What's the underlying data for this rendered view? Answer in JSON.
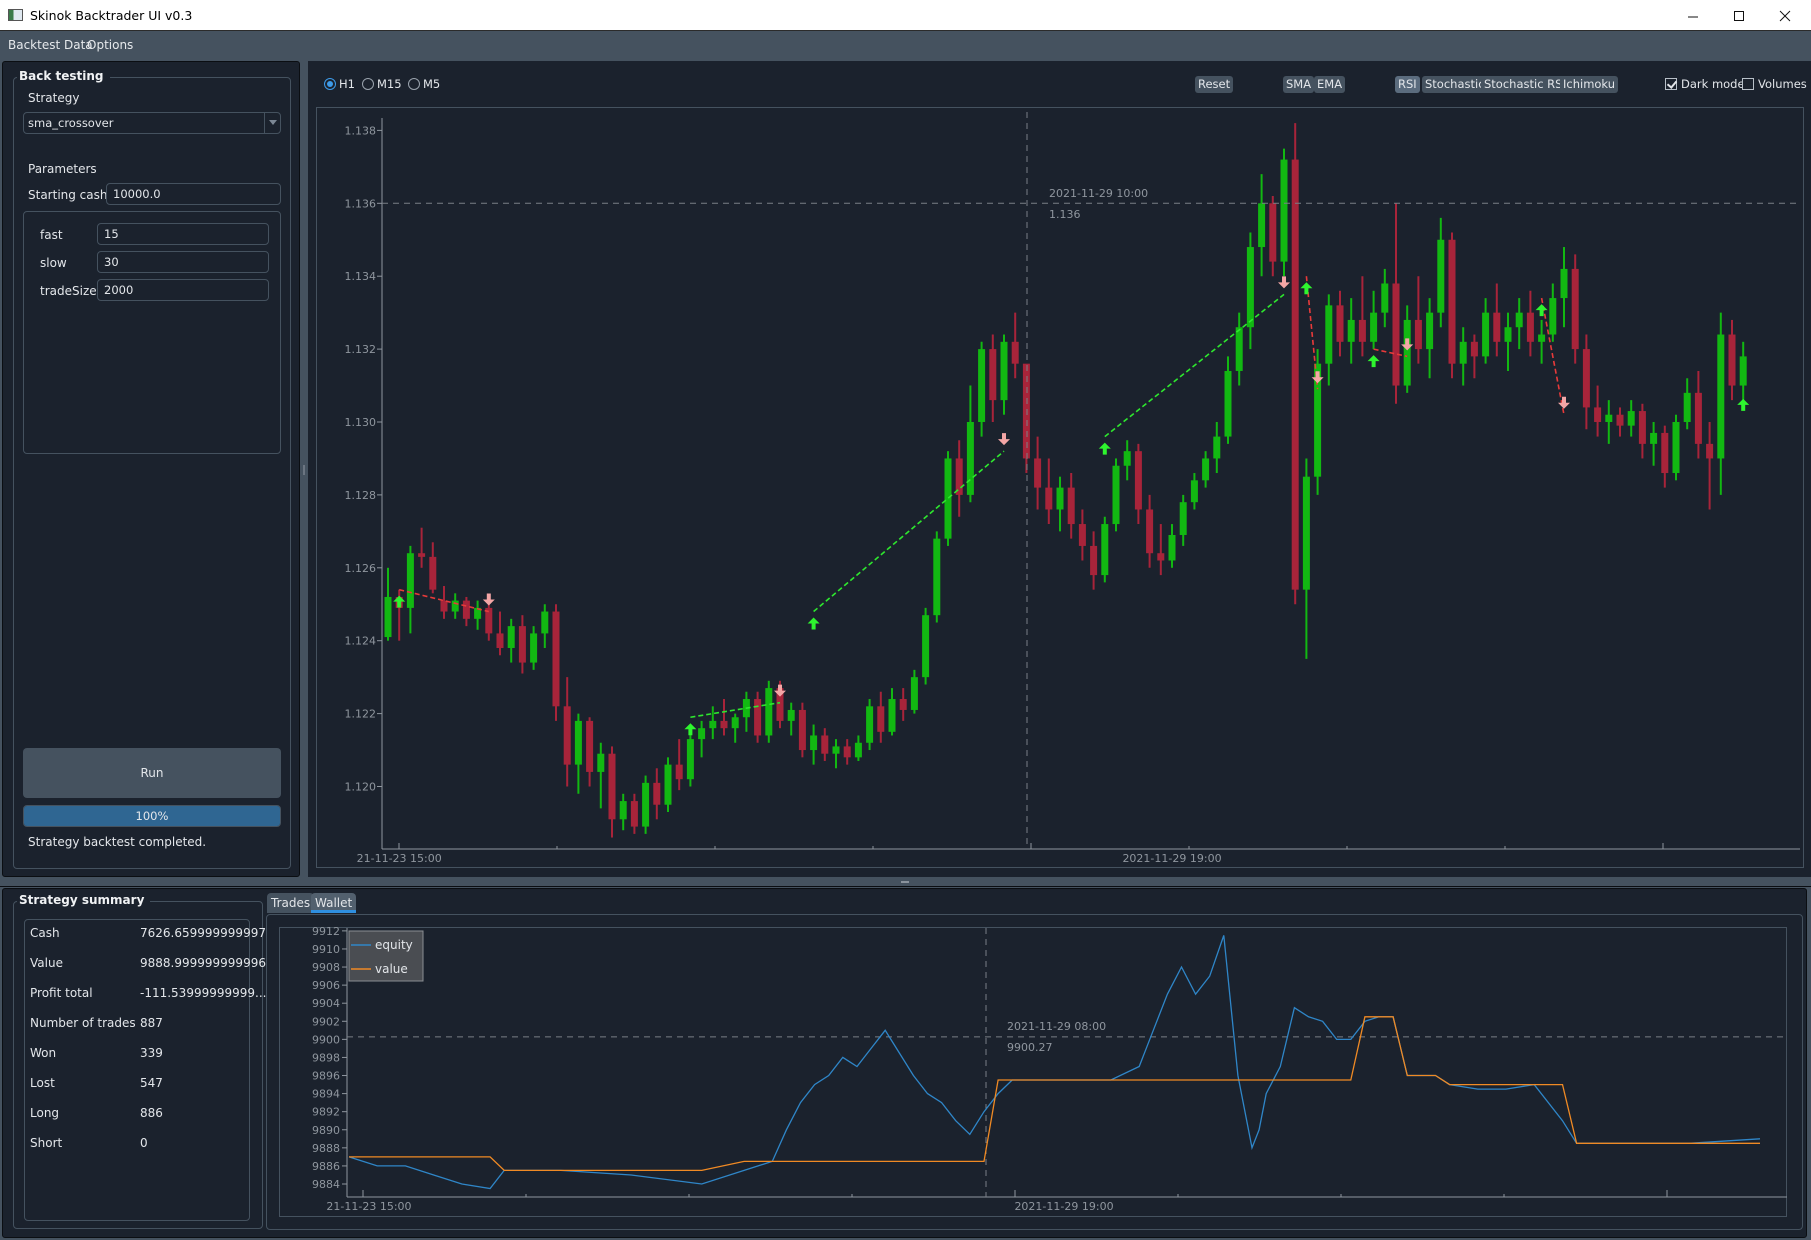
{
  "window": {
    "title": "Skinok Backtrader UI v0.3",
    "controls": [
      "minimize",
      "maximize",
      "close"
    ]
  },
  "menu": [
    "Backtest Data",
    "Options"
  ],
  "backtesting": {
    "group_title": "Back testing",
    "strategy_label": "Strategy",
    "strategy_value": "sma_crossover",
    "parameters_label": "Parameters",
    "starting_cash_label": "Starting cash",
    "starting_cash_value": "10000.0",
    "params": [
      {
        "name": "fast",
        "value": "15"
      },
      {
        "name": "slow",
        "value": "30"
      },
      {
        "name": "tradeSize",
        "value": "2000"
      }
    ],
    "run_label": "Run",
    "progress_percent": 100,
    "progress_text": "100%",
    "status_text": "Strategy backtest completed."
  },
  "toolbar": {
    "timeframes": [
      {
        "label": "H1",
        "selected": true
      },
      {
        "label": "M15",
        "selected": false
      },
      {
        "label": "M5",
        "selected": false
      }
    ],
    "reset_label": "Reset",
    "indicators": [
      {
        "label": "SMA",
        "active": false
      },
      {
        "label": "EMA",
        "active": false
      },
      {
        "label": "RSI",
        "active": true
      },
      {
        "label": "Stochastic",
        "active": false
      },
      {
        "label": "Stochastic RSI",
        "active": false
      },
      {
        "label": "Ichimoku",
        "active": false
      }
    ],
    "dark_mode_label": "Dark mode",
    "dark_mode_checked": true,
    "volumes_label": "Volumes",
    "volumes_checked": false
  },
  "colors": {
    "bull": "#12b812",
    "bear": "#a8243a",
    "buy_arrow": "#2ef52e",
    "sell_arrow": "#f4a6a6",
    "win_trade_line": "#2ee82e",
    "loss_trade_line": "#e83a3a",
    "equity": "#2f86c8",
    "value": "#f08a24",
    "axis_text": "#8f969e",
    "crosshair": "#7a7f86"
  },
  "price_chart": {
    "yticks": [
      "1.120",
      "1.122",
      "1.124",
      "1.126",
      "1.128",
      "1.130",
      "1.132",
      "1.134",
      "1.136",
      "1.138"
    ],
    "ylim": [
      1.1184,
      1.1385
    ],
    "xtick_labels": [
      {
        "index": 1,
        "label": "21-11-23 15:00"
      },
      {
        "index": 70,
        "label": "2021-11-29 19:00"
      }
    ],
    "crosshair": {
      "index": 57,
      "price": 1.136,
      "time_label": "2021-11-29 10:00",
      "price_label": "1.136"
    },
    "candles": [
      [
        1.1241,
        1.126,
        1.124,
        1.1252
      ],
      [
        1.1252,
        1.1254,
        1.124,
        1.1249
      ],
      [
        1.1249,
        1.1266,
        1.1242,
        1.1264
      ],
      [
        1.1264,
        1.1271,
        1.126,
        1.1263
      ],
      [
        1.1263,
        1.1267,
        1.1253,
        1.1254
      ],
      [
        1.1251,
        1.1255,
        1.1246,
        1.1248
      ],
      [
        1.1248,
        1.1253,
        1.1246,
        1.1251
      ],
      [
        1.1251,
        1.1252,
        1.1244,
        1.1246
      ],
      [
        1.1246,
        1.1251,
        1.1243,
        1.1249
      ],
      [
        1.1249,
        1.125,
        1.124,
        1.1242
      ],
      [
        1.1242,
        1.1248,
        1.1236,
        1.1238
      ],
      [
        1.1238,
        1.1246,
        1.1234,
        1.1244
      ],
      [
        1.1244,
        1.1247,
        1.1231,
        1.1234
      ],
      [
        1.1234,
        1.1244,
        1.1232,
        1.1242
      ],
      [
        1.1242,
        1.125,
        1.1238,
        1.1248
      ],
      [
        1.1248,
        1.125,
        1.1218,
        1.1222
      ],
      [
        1.1222,
        1.123,
        1.12,
        1.1206
      ],
      [
        1.1206,
        1.122,
        1.1198,
        1.1218
      ],
      [
        1.1218,
        1.1219,
        1.12,
        1.1204
      ],
      [
        1.1204,
        1.1212,
        1.1194,
        1.1209
      ],
      [
        1.1209,
        1.1211,
        1.1186,
        1.1191
      ],
      [
        1.1191,
        1.1198,
        1.1188,
        1.1196
      ],
      [
        1.1196,
        1.1198,
        1.1187,
        1.1189
      ],
      [
        1.1189,
        1.1203,
        1.1187,
        1.1201
      ],
      [
        1.1201,
        1.1205,
        1.1191,
        1.1195
      ],
      [
        1.1195,
        1.1208,
        1.1193,
        1.1206
      ],
      [
        1.1206,
        1.1213,
        1.1199,
        1.1202
      ],
      [
        1.1202,
        1.1215,
        1.12,
        1.1213
      ],
      [
        1.1213,
        1.1218,
        1.1208,
        1.1216
      ],
      [
        1.1216,
        1.1222,
        1.1213,
        1.1218
      ],
      [
        1.1218,
        1.1224,
        1.1214,
        1.1216
      ],
      [
        1.1216,
        1.122,
        1.1212,
        1.1219
      ],
      [
        1.1219,
        1.1226,
        1.1215,
        1.1224
      ],
      [
        1.1224,
        1.1226,
        1.1212,
        1.1214
      ],
      [
        1.1214,
        1.1229,
        1.1212,
        1.1227
      ],
      [
        1.1227,
        1.1229,
        1.1216,
        1.1218
      ],
      [
        1.1218,
        1.1223,
        1.1214,
        1.1221
      ],
      [
        1.1221,
        1.1223,
        1.1208,
        1.121
      ],
      [
        1.121,
        1.1217,
        1.1206,
        1.1214
      ],
      [
        1.1214,
        1.1216,
        1.1207,
        1.1209
      ],
      [
        1.1209,
        1.1213,
        1.1205,
        1.1211
      ],
      [
        1.1211,
        1.1213,
        1.1206,
        1.1208
      ],
      [
        1.1208,
        1.1214,
        1.1207,
        1.1212
      ],
      [
        1.1212,
        1.1224,
        1.121,
        1.1222
      ],
      [
        1.1222,
        1.1226,
        1.1212,
        1.1215
      ],
      [
        1.1215,
        1.1227,
        1.1214,
        1.1224
      ],
      [
        1.1224,
        1.1227,
        1.1218,
        1.1221
      ],
      [
        1.1221,
        1.1232,
        1.122,
        1.123
      ],
      [
        1.123,
        1.1249,
        1.1228,
        1.1247
      ],
      [
        1.1247,
        1.127,
        1.1245,
        1.1268
      ],
      [
        1.1268,
        1.1292,
        1.1266,
        1.129
      ],
      [
        1.129,
        1.1295,
        1.1274,
        1.128
      ],
      [
        1.128,
        1.131,
        1.1278,
        1.13
      ],
      [
        1.13,
        1.1322,
        1.1296,
        1.132
      ],
      [
        1.132,
        1.1324,
        1.13,
        1.1306
      ],
      [
        1.1306,
        1.1324,
        1.1302,
        1.1322
      ],
      [
        1.1322,
        1.133,
        1.1312,
        1.1316
      ],
      [
        1.1316,
        1.1306,
        1.1286,
        1.129
      ],
      [
        1.129,
        1.1296,
        1.1276,
        1.1282
      ],
      [
        1.1282,
        1.129,
        1.1272,
        1.1276
      ],
      [
        1.1276,
        1.1285,
        1.127,
        1.1282
      ],
      [
        1.1282,
        1.1286,
        1.1268,
        1.1272
      ],
      [
        1.1272,
        1.1276,
        1.1262,
        1.1266
      ],
      [
        1.1266,
        1.127,
        1.1254,
        1.1258
      ],
      [
        1.1258,
        1.1274,
        1.1256,
        1.1272
      ],
      [
        1.1272,
        1.129,
        1.127,
        1.1288
      ],
      [
        1.1288,
        1.1295,
        1.1284,
        1.1292
      ],
      [
        1.1292,
        1.1294,
        1.1272,
        1.1276
      ],
      [
        1.1276,
        1.128,
        1.126,
        1.1264
      ],
      [
        1.1264,
        1.1272,
        1.1258,
        1.1262
      ],
      [
        1.1262,
        1.1272,
        1.126,
        1.1269
      ],
      [
        1.1269,
        1.128,
        1.1266,
        1.1278
      ],
      [
        1.1278,
        1.1286,
        1.1276,
        1.1284
      ],
      [
        1.1284,
        1.1292,
        1.1282,
        1.129
      ],
      [
        1.129,
        1.13,
        1.1286,
        1.1296
      ],
      [
        1.1296,
        1.1318,
        1.1294,
        1.1314
      ],
      [
        1.1314,
        1.133,
        1.131,
        1.1326
      ],
      [
        1.1326,
        1.1352,
        1.132,
        1.1348
      ],
      [
        1.1348,
        1.1368,
        1.134,
        1.136
      ],
      [
        1.136,
        1.1362,
        1.134,
        1.1344
      ],
      [
        1.1344,
        1.1375,
        1.134,
        1.1372
      ],
      [
        1.1372,
        1.1382,
        1.125,
        1.1254
      ],
      [
        1.1254,
        1.129,
        1.1235,
        1.1285
      ],
      [
        1.1285,
        1.132,
        1.128,
        1.1316
      ],
      [
        1.1316,
        1.1335,
        1.131,
        1.1332
      ],
      [
        1.1332,
        1.1336,
        1.1318,
        1.1322
      ],
      [
        1.1322,
        1.1334,
        1.1316,
        1.1328
      ],
      [
        1.1328,
        1.134,
        1.1318,
        1.1322
      ],
      [
        1.1322,
        1.1336,
        1.132,
        1.133
      ],
      [
        1.133,
        1.1342,
        1.1326,
        1.1338
      ],
      [
        1.1338,
        1.136,
        1.1305,
        1.131
      ],
      [
        1.131,
        1.1332,
        1.1308,
        1.1328
      ],
      [
        1.1328,
        1.134,
        1.1316,
        1.132
      ],
      [
        1.132,
        1.1334,
        1.1312,
        1.133
      ],
      [
        1.133,
        1.1356,
        1.1326,
        1.135
      ],
      [
        1.135,
        1.1352,
        1.1312,
        1.1316
      ],
      [
        1.1316,
        1.1326,
        1.131,
        1.1322
      ],
      [
        1.1322,
        1.1324,
        1.1312,
        1.1318
      ],
      [
        1.1318,
        1.1334,
        1.1316,
        1.133
      ],
      [
        1.133,
        1.1338,
        1.1318,
        1.1322
      ],
      [
        1.1322,
        1.133,
        1.1314,
        1.1326
      ],
      [
        1.1326,
        1.1334,
        1.132,
        1.133
      ],
      [
        1.133,
        1.1336,
        1.1318,
        1.1322
      ],
      [
        1.1322,
        1.1328,
        1.1316,
        1.1324
      ],
      [
        1.1324,
        1.1338,
        1.1322,
        1.1334
      ],
      [
        1.1334,
        1.1348,
        1.1326,
        1.1342
      ],
      [
        1.1342,
        1.1346,
        1.1316,
        1.132
      ],
      [
        1.132,
        1.1324,
        1.1298,
        1.1304
      ],
      [
        1.1304,
        1.131,
        1.1296,
        1.13
      ],
      [
        1.13,
        1.1306,
        1.1294,
        1.1302
      ],
      [
        1.1302,
        1.1304,
        1.1296,
        1.1299
      ],
      [
        1.1299,
        1.1306,
        1.1296,
        1.1303
      ],
      [
        1.1303,
        1.1305,
        1.129,
        1.1294
      ],
      [
        1.1294,
        1.13,
        1.1288,
        1.1297
      ],
      [
        1.1297,
        1.1299,
        1.1282,
        1.1286
      ],
      [
        1.1286,
        1.1302,
        1.1284,
        1.13
      ],
      [
        1.13,
        1.1312,
        1.1298,
        1.1308
      ],
      [
        1.1308,
        1.1314,
        1.129,
        1.1294
      ],
      [
        1.1294,
        1.13,
        1.1276,
        1.129
      ],
      [
        1.129,
        1.133,
        1.128,
        1.1324
      ],
      [
        1.1324,
        1.1328,
        1.1306,
        1.131
      ],
      [
        1.131,
        1.1322,
        1.1306,
        1.1318
      ]
    ],
    "trades": [
      {
        "entry": 1,
        "entry_price": 1.1254,
        "exit": 9,
        "exit_price": 1.1248,
        "won": false
      },
      {
        "entry": 27,
        "entry_price": 1.1219,
        "exit": 35,
        "exit_price": 1.1223,
        "won": true
      },
      {
        "entry": 38,
        "entry_price": 1.1248,
        "exit": 55,
        "exit_price": 1.1292,
        "won": true
      },
      {
        "entry": 64,
        "entry_price": 1.1296,
        "exit": 80,
        "exit_price": 1.1335,
        "won": true
      },
      {
        "entry": 82,
        "entry_price": 1.134,
        "exit": 83,
        "exit_price": 1.1309,
        "won": false
      },
      {
        "entry": 88,
        "entry_price": 1.132,
        "exit": 91,
        "exit_price": 1.1318,
        "won": false
      },
      {
        "entry": 103,
        "entry_price": 1.1334,
        "exit": 105,
        "exit_price": 1.1302,
        "won": false
      },
      {
        "entry": 121,
        "entry_price": 1.1308,
        "exit": null,
        "exit_price": null,
        "won": null
      }
    ]
  },
  "summary": {
    "group_title": "Strategy summary",
    "rows": [
      {
        "label": "Cash",
        "value": "7626.659999999997"
      },
      {
        "label": "Value",
        "value": "9888.999999999996"
      },
      {
        "label": "Profit total",
        "value": "-111.53999999999..."
      },
      {
        "label": "Number of trades",
        "value": "887"
      },
      {
        "label": "Won",
        "value": "339"
      },
      {
        "label": "Lost",
        "value": "547"
      },
      {
        "label": "Long",
        "value": "886"
      },
      {
        "label": "Short",
        "value": "0"
      }
    ]
  },
  "tabs": [
    {
      "label": "Trades",
      "active": false
    },
    {
      "label": "Wallet",
      "active": true
    }
  ],
  "chart_data": {
    "type": "line",
    "title": "",
    "xlabel": "",
    "ylabel": "",
    "ylim": [
      9883,
      9912
    ],
    "yticks": [
      "9884",
      "9886",
      "9888",
      "9890",
      "9892",
      "9894",
      "9896",
      "9898",
      "9900",
      "9902",
      "9904",
      "9906",
      "9908",
      "9910",
      "9912"
    ],
    "xtick_labels": [
      {
        "t": 0.02,
        "label": "21-11-23 15:00"
      },
      {
        "t": 0.5,
        "label": "2021-11-29 19:00"
      }
    ],
    "legend": {
      "position": "top-left",
      "entries": [
        "equity",
        "value"
      ]
    },
    "crosshair": {
      "t": 0.45,
      "value": 9900.27,
      "time_label": "2021-11-29 08:00",
      "value_label": "9900.27"
    },
    "x": [
      0,
      0.02,
      0.04,
      0.06,
      0.08,
      0.1,
      0.11,
      0.13,
      0.15,
      0.2,
      0.25,
      0.28,
      0.3,
      0.31,
      0.32,
      0.33,
      0.34,
      0.35,
      0.36,
      0.37,
      0.38,
      0.39,
      0.4,
      0.41,
      0.42,
      0.43,
      0.44,
      0.45,
      0.46,
      0.47,
      0.48,
      0.5,
      0.54,
      0.56,
      0.57,
      0.58,
      0.59,
      0.6,
      0.61,
      0.62,
      0.63,
      0.64,
      0.645,
      0.65,
      0.66,
      0.67,
      0.68,
      0.69,
      0.7,
      0.71,
      0.72,
      0.73,
      0.74,
      0.75,
      0.76,
      0.77,
      0.78,
      0.8,
      0.82,
      0.84,
      0.86,
      0.87,
      0.88,
      0.9,
      0.95,
      1.0
    ],
    "series": [
      {
        "name": "equity",
        "values": [
          9887,
          9886,
          9886,
          9885,
          9884,
          9883.5,
          9885.5,
          9885.5,
          9885.5,
          9885,
          9884,
          9885.5,
          9886.5,
          9890,
          9893,
          9895,
          9896,
          9898,
          9897,
          9899,
          9901,
          9898.5,
          9896,
          9894,
          9893,
          9891,
          9889.5,
          9892,
          9894,
          9895.5,
          9895.5,
          9895.5,
          9895.5,
          9897,
          9901,
          9905,
          9908,
          9905,
          9907,
          9911.5,
          9896,
          9888,
          9890,
          9894,
          9897,
          9903.5,
          9902.5,
          9902,
          9900,
          9900,
          9902,
          9902.5,
          9902.5,
          9896,
          9896,
          9896,
          9895,
          9894.5,
          9894.5,
          9895,
          9891,
          9888.5,
          9888.5,
          9888.5,
          9888.5,
          9889
        ]
      },
      {
        "name": "value",
        "values": [
          9887,
          9887,
          9887,
          9887,
          9887,
          9887,
          9885.5,
          9885.5,
          9885.5,
          9885.5,
          9885.5,
          9886.5,
          9886.5,
          9886.5,
          9886.5,
          9886.5,
          9886.5,
          9886.5,
          9886.5,
          9886.5,
          9886.5,
          9886.5,
          9886.5,
          9886.5,
          9886.5,
          9886.5,
          9886.5,
          9886.5,
          9895.5,
          9895.5,
          9895.5,
          9895.5,
          9895.5,
          9895.5,
          9895.5,
          9895.5,
          9895.5,
          9895.5,
          9895.5,
          9895.5,
          9895.5,
          9895.5,
          9895.5,
          9895.5,
          9895.5,
          9895.5,
          9895.5,
          9895.5,
          9895.5,
          9895.5,
          9902.5,
          9902.5,
          9902.5,
          9896,
          9896,
          9896,
          9895,
          9895,
          9895,
          9895,
          9895,
          9888.5,
          9888.5,
          9888.5,
          9888.5,
          9888.5
        ]
      }
    ]
  }
}
